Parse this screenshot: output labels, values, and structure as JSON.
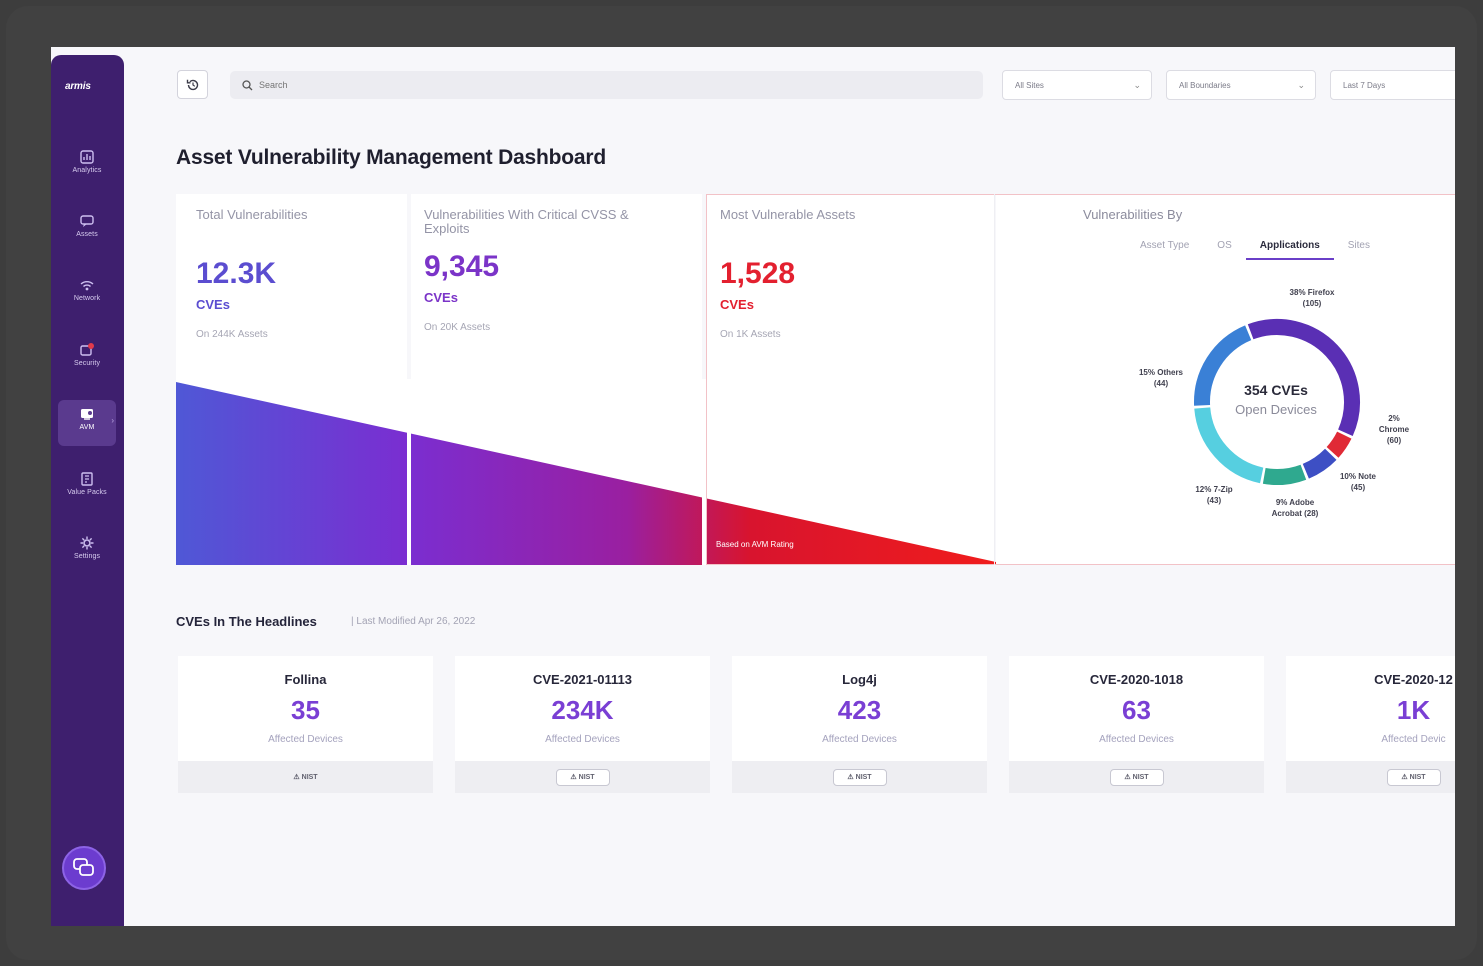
{
  "sidebar": {
    "logo": "armis",
    "items": [
      {
        "label": "Analytics",
        "icon": "chart-icon"
      },
      {
        "label": "Assets",
        "icon": "chat-icon"
      },
      {
        "label": "Network",
        "icon": "wifi-icon"
      },
      {
        "label": "Security",
        "icon": "shield-alert-icon"
      },
      {
        "label": "AVM",
        "icon": "vulnerability-icon"
      },
      {
        "label": "Value Packs",
        "icon": "pack-icon"
      },
      {
        "label": "Settings",
        "icon": "gear-icon"
      }
    ],
    "active_item": "AVM"
  },
  "topbar": {
    "search_placeholder": "Search",
    "filters": [
      {
        "label": "All Sites"
      },
      {
        "label": "All Boundaries"
      },
      {
        "label": "Last 7 Days"
      }
    ]
  },
  "page": {
    "title": "Asset Vulnerability Management Dashboard"
  },
  "kpis": [
    {
      "label": "Total Vulnerabilities",
      "value": "12.3K",
      "unit": "CVEs",
      "sub": "On 244K Assets",
      "color": "#5b4dd0"
    },
    {
      "label": "Vulnerabilities With Critical CVSS & Exploits",
      "value": "9,345",
      "unit": "CVEs",
      "sub": "On 20K Assets",
      "color": "#7b34c8"
    },
    {
      "label": "Most Vulnerable Assets",
      "value": "1,528",
      "unit": "CVEs",
      "sub": "On 1K Assets",
      "color": "#e3202f"
    }
  ],
  "wedge_note": "Based on AVM Rating",
  "vulnerabilities_by": {
    "title": "Vulnerabilities By",
    "tabs": [
      "Asset Type",
      "OS",
      "Applications",
      "Sites"
    ],
    "active_tab": "Applications",
    "center_title": "354 CVEs",
    "center_sub": "Open Devices",
    "segments": [
      {
        "label": "38% Firefox (105)",
        "value": 38,
        "color": "#5a2fb4"
      },
      {
        "label": "2% Chrome (60)",
        "value": 5,
        "color": "#e02a36"
      },
      {
        "label": "10% Note (45)",
        "value": 7,
        "color": "#3d4fc4"
      },
      {
        "label": "9% Adobe Acrobat (28)",
        "value": 9,
        "color": "#2fa98f"
      },
      {
        "label": "12% 7-Zip (43)",
        "value": 21,
        "color": "#56cfe0"
      },
      {
        "label": "15% Others (44)",
        "value": 20,
        "color": "#3a80d6"
      }
    ]
  },
  "headlines": {
    "title": "CVEs In The Headlines",
    "updated": "| Last Modified Apr 26, 2022",
    "cards": [
      {
        "name": "Follina",
        "count": "35",
        "affected": "Affected Devices",
        "button": "NIST"
      },
      {
        "name": "CVE-2021-01113",
        "count": "234K",
        "affected": "Affected Devices",
        "button": "NIST"
      },
      {
        "name": "Log4j",
        "count": "423",
        "affected": "Affected Devices",
        "button": "NIST"
      },
      {
        "name": "CVE-2020-1018",
        "count": "63",
        "affected": "Affected Devices",
        "button": "NIST"
      },
      {
        "name": "CVE-2020-12",
        "count": "1K",
        "affected": "Affected Devic",
        "button": "NIST"
      }
    ]
  }
}
